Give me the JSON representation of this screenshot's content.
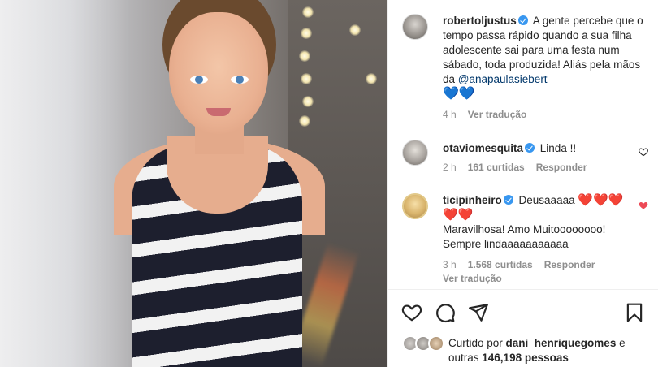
{
  "post": {
    "author": "robertoljustus",
    "caption": "A gente percebe que o tempo passa rápido quando a sua filha adolescente sai para uma festa num sábado, toda produzida! Aliás pela mãos da ",
    "mention": "@anapaulasiebert",
    "caption_emoji": "💙💙",
    "time": "4 h",
    "see_translation": "Ver tradução"
  },
  "comments": [
    {
      "user": "otaviomesquita",
      "text": "Linda !!",
      "time": "2 h",
      "likes": "161 curtidas",
      "reply": "Responder",
      "liked": false
    },
    {
      "user": "ticipinheiro",
      "text_a": "Deusaaaaa",
      "emoji_a": "❤️❤️❤️",
      "emoji_b": "❤️❤️",
      "text_b": "Maravilhosa! Amo Muitoooooooo! Sempre lindaaaaaaaaaaa",
      "time": "3 h",
      "likes": "1.568 curtidas",
      "reply": "Responder",
      "see_translation": "Ver tradução",
      "liked": true
    }
  ],
  "footer": {
    "liked_by_prefix": "Curtido por ",
    "liked_by_user": "dani_henriquegomes",
    "liked_by_suffix": " e",
    "others_prefix": "outras ",
    "others_count": "146,198 pessoas"
  },
  "icons": {
    "like": "heart-outline-icon",
    "comment": "comment-icon",
    "share": "send-icon",
    "save": "bookmark-icon"
  },
  "colors": {
    "verified": "#3897f0",
    "mention": "#00376b",
    "secondary_text": "#8e8e8e",
    "liked_heart": "#ed4956"
  }
}
